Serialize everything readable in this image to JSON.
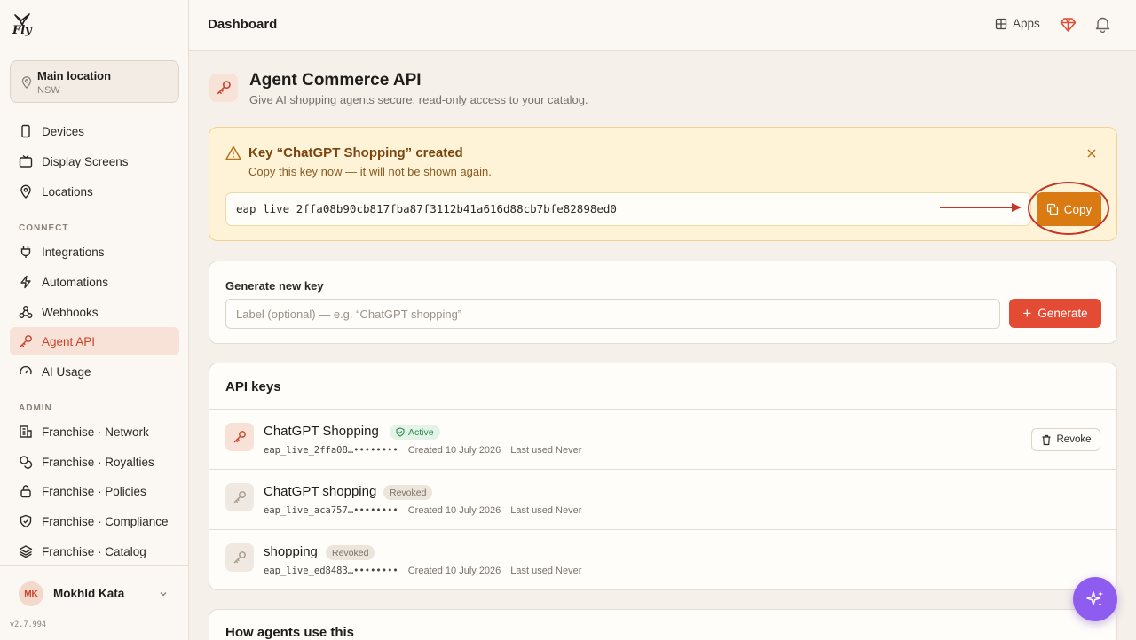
{
  "brand": {
    "logo_text": "Fly"
  },
  "location": {
    "name": "Main location",
    "region": "NSW"
  },
  "sidebar": {
    "items_top": [
      {
        "label": "Devices",
        "icon": "phone-icon"
      },
      {
        "label": "Display Screens",
        "icon": "tv-icon"
      },
      {
        "label": "Locations",
        "icon": "map-pin-icon"
      }
    ],
    "connect_label": "CONNECT",
    "items_connect": [
      {
        "label": "Integrations",
        "icon": "plug-icon"
      },
      {
        "label": "Automations",
        "icon": "zap-icon"
      },
      {
        "label": "Webhooks",
        "icon": "webhook-icon"
      },
      {
        "label": "Agent API",
        "icon": "key-icon",
        "active": true
      },
      {
        "label": "AI Usage",
        "icon": "gauge-icon"
      }
    ],
    "admin_label": "ADMIN",
    "items_admin": [
      {
        "label": "Franchise · Network",
        "icon": "building-icon"
      },
      {
        "label": "Franchise · Royalties",
        "icon": "coins-icon"
      },
      {
        "label": "Franchise · Policies",
        "icon": "lock-icon"
      },
      {
        "label": "Franchise · Compliance",
        "icon": "shield-icon"
      },
      {
        "label": "Franchise · Catalog",
        "icon": "layers-icon"
      }
    ]
  },
  "user": {
    "initials": "MK",
    "name": "Mokhld Kata"
  },
  "version": "v2.7.994",
  "header": {
    "title": "Dashboard",
    "apps_label": "Apps"
  },
  "page": {
    "title": "Agent Commerce API",
    "subtitle": "Give AI shopping agents secure, read-only access to your catalog."
  },
  "alert": {
    "title": "Key “ChatGPT Shopping” created",
    "subtitle": "Copy this key now — it will not be shown again.",
    "key_value": "eap_live_2ffa08b90cb817fba87f3112b41a616d88cb7bfe82898ed0",
    "copy_label": "Copy"
  },
  "generate": {
    "label": "Generate new key",
    "placeholder": "Label (optional) — e.g. “ChatGPT shopping”",
    "button_label": "Generate"
  },
  "keys": {
    "header": "API keys",
    "revoke_label": "Revoke",
    "rows": [
      {
        "name": "ChatGPT Shopping",
        "status": "Active",
        "masked": "eap_live_2ffa08…••••••••",
        "created": "Created 10 July 2026",
        "last_used": "Last used Never"
      },
      {
        "name": "ChatGPT shopping",
        "status": "Revoked",
        "masked": "eap_live_aca757…••••••••",
        "created": "Created 10 July 2026",
        "last_used": "Last used Never"
      },
      {
        "name": "shopping",
        "status": "Revoked",
        "masked": "eap_live_ed8483…••••••••",
        "created": "Created 10 July 2026",
        "last_used": "Last used Never"
      }
    ]
  },
  "how": {
    "header": "How agents use this"
  },
  "colors": {
    "accent": "#e34b34",
    "warning_bg": "#fef3d6",
    "copy_button": "#d97b12",
    "fab": "#8f5cf0"
  }
}
